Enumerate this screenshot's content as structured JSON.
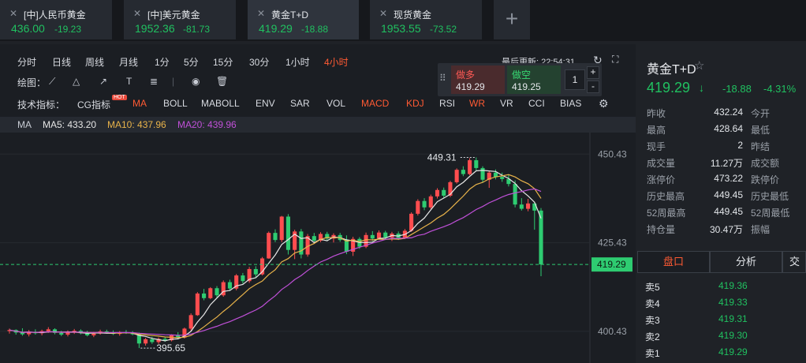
{
  "tabs": [
    {
      "name": "[中]人民币黄金",
      "price": "436.00",
      "change": "-19.23"
    },
    {
      "name": "[中]美元黄金",
      "price": "1952.36",
      "change": "-81.73"
    },
    {
      "name": "黄金T+D",
      "price": "419.29",
      "change": "-18.88"
    },
    {
      "name": "现货黄金",
      "price": "1953.55",
      "change": "-73.52"
    }
  ],
  "add_tab": "+",
  "periods": [
    "分时",
    "日线",
    "周线",
    "月线",
    "1分",
    "5分",
    "15分",
    "30分",
    "1小时",
    "4小时"
  ],
  "active_period": "4小时",
  "last_update": "最后更新: 22:54:31",
  "draw_label": "绘图：",
  "indicators_label": "技术指标：",
  "indicators": [
    "CG指标",
    "MA",
    "BOLL",
    "MABOLL",
    "ENV",
    "SAR",
    "VOL",
    "MACD",
    "KDJ",
    "RSI",
    "WR",
    "VR",
    "CCI",
    "BIAS"
  ],
  "active_indicators": [
    "MA",
    "MACD",
    "KDJ",
    "WR"
  ],
  "hot_badge": "HOT",
  "ma_legend": {
    "ma": "MA",
    "ma5": "MA5: 433.20",
    "ma10": "MA10: 437.96",
    "ma20": "MA20: 439.96"
  },
  "colors": {
    "up": "#ff4d4f",
    "down": "#2ecc71",
    "ma5": "#e6e6e6",
    "ma10": "#e8b34a",
    "ma20": "#c050d8",
    "accent": "#ff5a33"
  },
  "trade": {
    "buy_label": "做多",
    "buy_price": "419.29",
    "sell_label": "做空",
    "sell_price": "419.25",
    "qty": "1",
    "plus": "+",
    "minus": "-"
  },
  "chart_data": {
    "type": "candlestick",
    "y_ticks": [
      "450.43",
      "425.43",
      "400.43"
    ],
    "ylim": [
      391.5,
      456.5
    ],
    "current_price": "419.29",
    "high_marker": "449.31",
    "low_marker": "395.65",
    "candles": [
      [
        400.5,
        401.2,
        399.8,
        400.8
      ],
      [
        400.8,
        401.0,
        399.5,
        400.1
      ],
      [
        400.1,
        401.3,
        399.2,
        399.6
      ],
      [
        399.6,
        400.8,
        399.0,
        400.3
      ],
      [
        400.3,
        401.0,
        399.5,
        399.9
      ],
      [
        399.9,
        400.9,
        399.3,
        400.5
      ],
      [
        400.5,
        401.6,
        400.0,
        401.0
      ],
      [
        401.0,
        401.3,
        399.6,
        400.0
      ],
      [
        400.0,
        400.6,
        399.1,
        399.5
      ],
      [
        399.5,
        400.7,
        399.0,
        400.2
      ],
      [
        400.2,
        401.1,
        399.7,
        400.6
      ],
      [
        400.6,
        401.0,
        399.6,
        399.9
      ],
      [
        399.9,
        400.6,
        399.0,
        399.3
      ],
      [
        399.3,
        400.3,
        398.8,
        399.8
      ],
      [
        399.8,
        400.9,
        399.5,
        400.4
      ],
      [
        400.4,
        400.9,
        399.8,
        400.1
      ],
      [
        400.1,
        400.7,
        399.4,
        399.7
      ],
      [
        399.7,
        400.5,
        399.2,
        400.2
      ],
      [
        400.2,
        400.8,
        399.7,
        400.0
      ],
      [
        400.0,
        400.5,
        399.3,
        399.6
      ],
      [
        399.6,
        400.1,
        395.7,
        397.0
      ],
      [
        397.0,
        398.6,
        396.4,
        398.2
      ],
      [
        398.2,
        398.9,
        396.9,
        397.4
      ],
      [
        397.4,
        398.7,
        396.9,
        398.3
      ],
      [
        398.3,
        398.9,
        397.5,
        397.9
      ],
      [
        397.9,
        399.6,
        397.6,
        399.3
      ],
      [
        399.3,
        400.2,
        398.2,
        398.7
      ],
      [
        398.7,
        401.5,
        398.4,
        401.2
      ],
      [
        401.2,
        405.5,
        400.6,
        405.0
      ],
      [
        405.0,
        411.5,
        404.8,
        411.1
      ],
      [
        411.1,
        412.4,
        409.2,
        409.8
      ],
      [
        409.8,
        412.9,
        409.5,
        412.6
      ],
      [
        412.6,
        413.2,
        410.0,
        410.6
      ],
      [
        410.6,
        414.8,
        410.2,
        414.3
      ],
      [
        414.3,
        415.0,
        411.8,
        412.5
      ],
      [
        412.5,
        416.6,
        412.0,
        416.2
      ],
      [
        416.2,
        416.9,
        413.9,
        414.6
      ],
      [
        414.6,
        418.6,
        414.1,
        418.0
      ],
      [
        418.0,
        418.8,
        415.7,
        416.5
      ],
      [
        416.5,
        421.4,
        416.2,
        421.0
      ],
      [
        421.0,
        428.6,
        420.9,
        428.2
      ],
      [
        428.2,
        429.2,
        425.6,
        426.2
      ],
      [
        426.2,
        433.0,
        425.6,
        432.8
      ],
      [
        432.8,
        433.5,
        422.1,
        423.4
      ],
      [
        423.4,
        429.1,
        420.8,
        428.6
      ],
      [
        428.6,
        429.3,
        421.0,
        422.1
      ],
      [
        422.1,
        427.9,
        421.5,
        427.3
      ],
      [
        427.3,
        428.2,
        425.3,
        426.0
      ],
      [
        426.0,
        428.4,
        425.6,
        427.9
      ],
      [
        427.9,
        428.5,
        426.0,
        426.6
      ],
      [
        426.6,
        428.1,
        425.5,
        427.6
      ],
      [
        427.6,
        428.2,
        425.7,
        426.2
      ],
      [
        426.2,
        427.5,
        422.2,
        422.9
      ],
      [
        422.9,
        427.1,
        421.7,
        426.5
      ],
      [
        426.5,
        427.0,
        423.7,
        424.3
      ],
      [
        424.3,
        428.3,
        423.9,
        427.6
      ],
      [
        427.6,
        428.7,
        425.9,
        426.6
      ],
      [
        426.6,
        428.9,
        426.4,
        428.3
      ],
      [
        428.3,
        428.8,
        426.2,
        426.9
      ],
      [
        426.9,
        428.5,
        425.9,
        428.0
      ],
      [
        428.0,
        428.6,
        426.2,
        426.8
      ],
      [
        426.8,
        429.3,
        426.5,
        428.8
      ],
      [
        428.8,
        434.0,
        428.5,
        433.6
      ],
      [
        433.6,
        437.7,
        433.1,
        437.2
      ],
      [
        437.2,
        438.0,
        434.6,
        435.4
      ],
      [
        435.4,
        439.0,
        434.9,
        438.5
      ],
      [
        438.5,
        440.8,
        437.9,
        440.3
      ],
      [
        440.3,
        441.0,
        437.9,
        438.7
      ],
      [
        438.7,
        442.9,
        438.3,
        442.5
      ],
      [
        442.5,
        446.4,
        442.1,
        446.0
      ],
      [
        446.0,
        447.0,
        444.2,
        444.8
      ],
      [
        444.8,
        449.3,
        444.5,
        448.7
      ],
      [
        448.7,
        449.5,
        445.8,
        446.5
      ],
      [
        446.5,
        447.0,
        442.3,
        443.2
      ],
      [
        443.2,
        445.7,
        440.9,
        445.2
      ],
      [
        445.2,
        446.1,
        443.3,
        444.0
      ],
      [
        444.0,
        445.2,
        442.6,
        443.4
      ],
      [
        443.4,
        444.5,
        441.3,
        442.0
      ],
      [
        442.0,
        443.0,
        435.4,
        436.2
      ],
      [
        436.2,
        438.0,
        434.5,
        435.0
      ],
      [
        435.0,
        437.8,
        434.3,
        436.5
      ],
      [
        436.5,
        437.0,
        429.1,
        434.5
      ],
      [
        434.5,
        435.2,
        416.0,
        419.3
      ]
    ]
  },
  "right_panel": {
    "name": "黄金T+D",
    "star": "☆",
    "price": "419.29",
    "arrow": "↓",
    "change": "-18.88",
    "pct": "-4.31%",
    "stats": [
      {
        "label": "昨收",
        "value": "432.24",
        "label2": "今开"
      },
      {
        "label": "最高",
        "value": "428.64",
        "label2": "最低"
      },
      {
        "label": "现手",
        "value": "2",
        "label2": "昨结"
      },
      {
        "label": "成交量",
        "value": "11.27万",
        "label2": "成交额"
      },
      {
        "label": "涨停价",
        "value": "473.22",
        "label2": "跌停价"
      },
      {
        "label": "历史最高",
        "value": "449.45",
        "label2": "历史最低"
      },
      {
        "label": "52周最高",
        "value": "449.45",
        "label2": "52周最低"
      },
      {
        "label": "持仓量",
        "value": "30.47万",
        "label2": "振幅"
      }
    ],
    "tabs": [
      "盘口",
      "分析",
      "交"
    ],
    "orderbook": [
      {
        "label": "卖5",
        "price": "419.36"
      },
      {
        "label": "卖4",
        "price": "419.33"
      },
      {
        "label": "卖3",
        "price": "419.31"
      },
      {
        "label": "卖2",
        "price": "419.30"
      },
      {
        "label": "卖1",
        "price": "419.29"
      }
    ]
  }
}
